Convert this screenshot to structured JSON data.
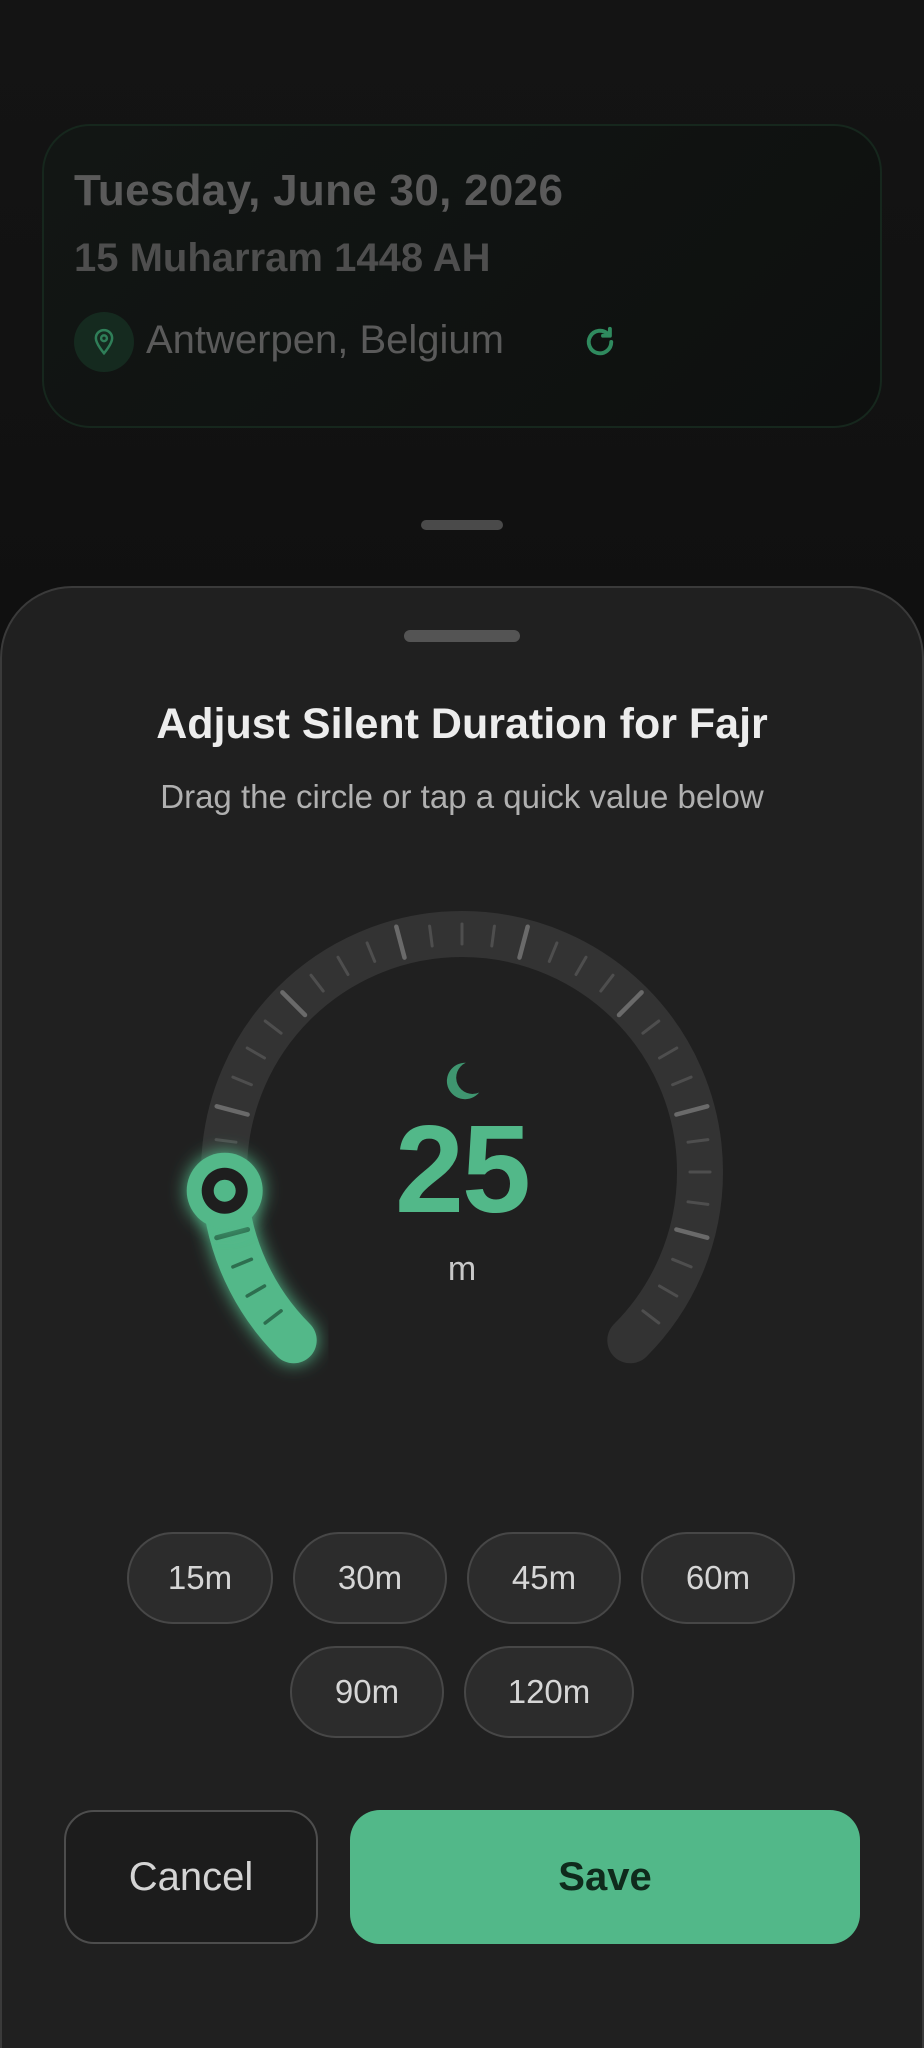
{
  "background_card": {
    "gregorian_date": "Tuesday, June 30, 2026",
    "hijri_date": "15 Muharram 1448 AH",
    "location": "Antwerpen, Belgium",
    "location_icon": "map-pin-icon",
    "refresh_icon": "refresh-icon"
  },
  "sheet": {
    "title": "Adjust Silent Duration for Fajr",
    "subtitle": "Drag the circle or tap a quick value below",
    "dial": {
      "value": "25",
      "unit": "m",
      "prayer_icon": "moon-icon",
      "level_fraction": 0.15
    },
    "quick_values": [
      {
        "label": "15m"
      },
      {
        "label": "30m"
      },
      {
        "label": "45m"
      },
      {
        "label": "60m"
      },
      {
        "label": "90m"
      },
      {
        "label": "120m"
      }
    ],
    "cancel_label": "Cancel",
    "save_label": "Save"
  },
  "colors": {
    "accent": "#52b889",
    "sheet_background": "#202020",
    "track": "#333333"
  }
}
